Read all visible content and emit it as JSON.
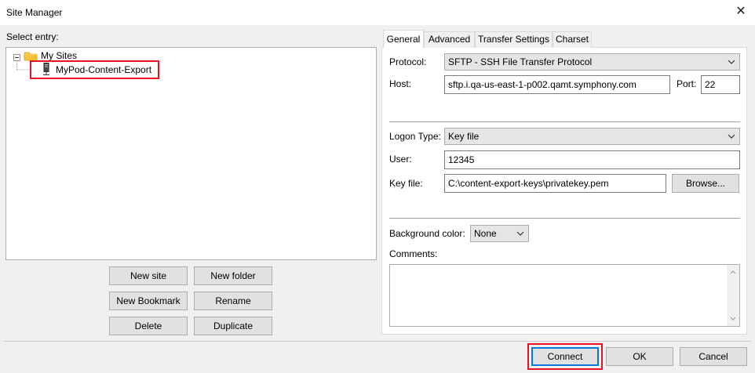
{
  "window": {
    "title": "Site Manager",
    "close_label": "✕"
  },
  "left": {
    "select_entry_label": "Select entry:",
    "tree": [
      {
        "label": "My Sites",
        "type": "folder",
        "expanded": true
      },
      {
        "label": "MyPod-Content-Export",
        "type": "site",
        "selected": true
      }
    ],
    "buttons": {
      "new_site": "New site",
      "new_folder": "New folder",
      "new_bookmark": "New Bookmark",
      "rename": "Rename",
      "delete": "Delete",
      "duplicate": "Duplicate"
    }
  },
  "tabs": [
    {
      "label": "General",
      "active": true
    },
    {
      "label": "Advanced",
      "active": false
    },
    {
      "label": "Transfer Settings",
      "active": false
    },
    {
      "label": "Charset",
      "active": false
    }
  ],
  "general": {
    "protocol_label": "Protocol:",
    "protocol_value": "SFTP - SSH File Transfer Protocol",
    "host_label": "Host:",
    "host_value": "sftp.i.qa-us-east-1-p002.qamt.symphony.com",
    "port_label": "Port:",
    "port_value": "22",
    "logon_type_label": "Logon Type:",
    "logon_type_value": "Key file",
    "user_label": "User:",
    "user_value": "12345",
    "key_file_label": "Key file:",
    "key_file_value": "C:\\content-export-keys\\privatekey.pem",
    "browse_label": "Browse...",
    "background_color_label": "Background color:",
    "background_color_value": "None",
    "comments_label": "Comments:",
    "comments_value": ""
  },
  "footer": {
    "connect_label": "Connect",
    "ok_label": "OK",
    "cancel_label": "Cancel"
  },
  "colors": {
    "highlight_red": "#e81123",
    "focus_blue": "#0078d7",
    "folder_yellow": "#f8c23a"
  }
}
